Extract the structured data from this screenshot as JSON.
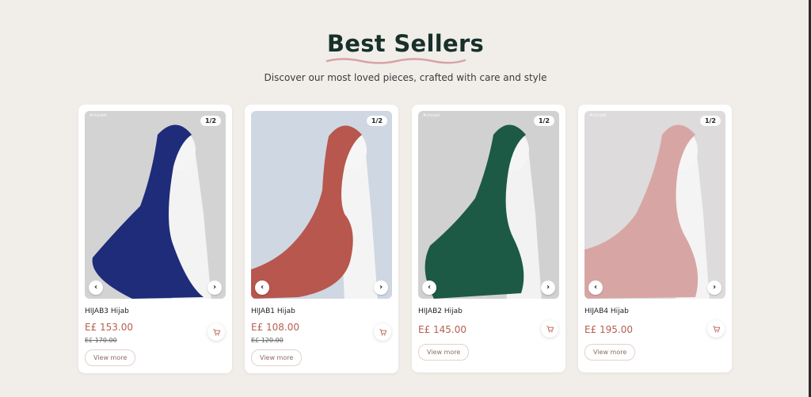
{
  "header": {
    "title": "Best Sellers",
    "subtitle": "Discover our most loved pieces, crafted with care and style"
  },
  "products": [
    {
      "name": "HIJAB3 Hijab",
      "price": "E£ 153.00",
      "old_price": "E£ 170.00",
      "counter": "1/2",
      "watermark": "#cliyabil",
      "scarf_color": "#1f2c7a",
      "bg_color": "#d3d3d3",
      "view_label": "View more"
    },
    {
      "name": "HIJAB1 Hijab",
      "price": "E£ 108.00",
      "old_price": "E£ 120.00",
      "counter": "1/2",
      "watermark": "",
      "scarf_color": "#b7574d",
      "bg_color": "#cfd7e2",
      "view_label": "View more"
    },
    {
      "name": "HIJAB2 Hijab",
      "price": "E£ 145.00",
      "old_price": "",
      "counter": "1/2",
      "watermark": "#cliyabil",
      "scarf_color": "#1c5a46",
      "bg_color": "#d1d1d1",
      "view_label": "View more"
    },
    {
      "name": "HIJAB4 Hijab",
      "price": "E£ 195.00",
      "old_price": "",
      "counter": "1/2",
      "watermark": "#cliyabil",
      "scarf_color": "#d7a6a4",
      "bg_color": "#dddbdb",
      "view_label": "View more"
    }
  ],
  "colors": {
    "accent": "#b5604f",
    "title": "#17302a",
    "underline": "#d9a2a4",
    "background": "#f1eeea"
  },
  "icons": {
    "prev": "chevron-left-icon",
    "next": "chevron-right-icon",
    "cart": "cart-icon"
  }
}
